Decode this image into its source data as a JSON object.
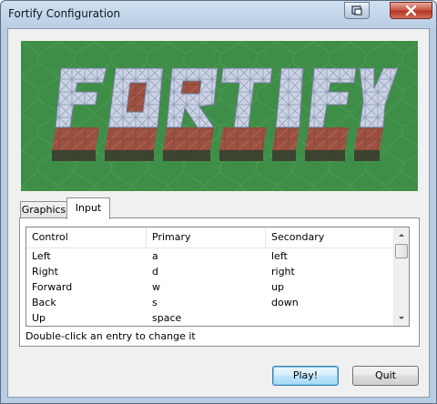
{
  "window": {
    "title": "Fortify Configuration",
    "title_buttons": [
      "restore-icon",
      "close-icon"
    ]
  },
  "banner": {
    "logo_text": "FORTIFY",
    "background_color": "#3e8f47"
  },
  "tabs": [
    {
      "label": "Graphics",
      "active": false
    },
    {
      "label": "Input",
      "active": true
    }
  ],
  "input_list": {
    "columns": [
      "Control",
      "Primary",
      "Secondary"
    ],
    "rows": [
      {
        "control": "Left",
        "primary": "a",
        "secondary": "left"
      },
      {
        "control": "Right",
        "primary": "d",
        "secondary": "right"
      },
      {
        "control": "Forward",
        "primary": "w",
        "secondary": "up"
      },
      {
        "control": "Back",
        "primary": "s",
        "secondary": "down"
      },
      {
        "control": "Up",
        "primary": "space",
        "secondary": ""
      }
    ],
    "hint": "Double-click an entry to change it"
  },
  "buttons": {
    "play_label": "Play!",
    "quit_label": "Quit"
  },
  "colors": {
    "accent": "#3c7fb1",
    "logo_top": "#c9d2e3",
    "logo_side": "#9c5242"
  }
}
